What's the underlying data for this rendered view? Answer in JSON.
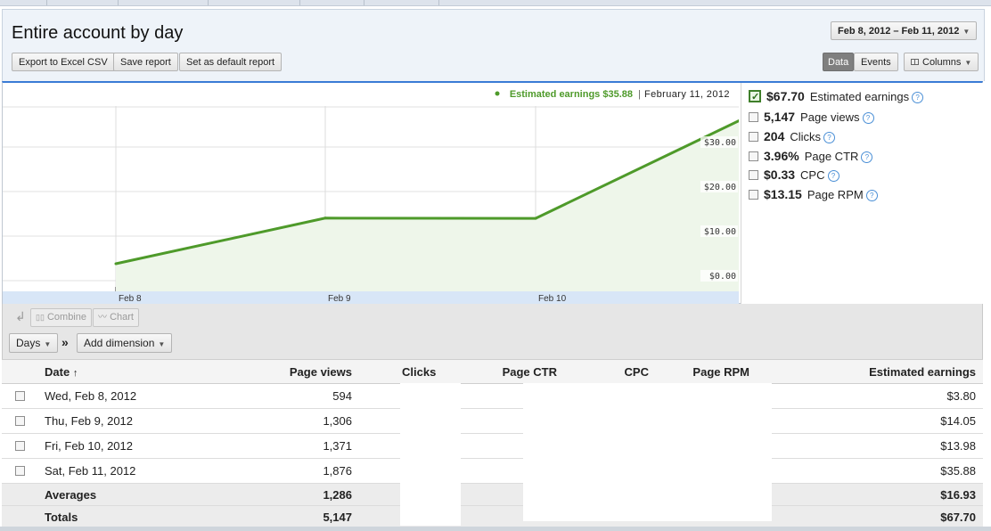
{
  "header": {
    "title": "Entire account by day",
    "date_range": "Feb 8, 2012 – Feb 11, 2012",
    "export_label": "Export to Excel CSV",
    "save_label": "Save report",
    "default_label": "Set as default report",
    "view_data": "Data",
    "view_events": "Events",
    "columns_label": "Columns"
  },
  "chart": {
    "legend_series": "Estimated earnings $35.88",
    "legend_date": "February 11, 2012",
    "line_color": "#4e9a2a",
    "fill_color": "#eef6ea"
  },
  "chart_data": {
    "type": "area",
    "x": [
      "Feb 8",
      "Feb 9",
      "Feb 10",
      "Feb 11"
    ],
    "xticks": [
      "Feb 8",
      "Feb 9",
      "Feb 10"
    ],
    "yticks": [
      "$0.00",
      "$10.00",
      "$20.00",
      "$30.00"
    ],
    "ylim": [
      0,
      35
    ],
    "series": [
      {
        "name": "Estimated earnings",
        "values": [
          3.8,
          14.05,
          13.98,
          35.88
        ]
      }
    ],
    "grid": true
  },
  "metrics": [
    {
      "value": "$67.70",
      "label": "Estimated earnings",
      "checked": true
    },
    {
      "value": "5,147",
      "label": "Page views",
      "checked": false
    },
    {
      "value": "204",
      "label": "Clicks",
      "checked": false
    },
    {
      "value": "3.96%",
      "label": "Page CTR",
      "checked": false
    },
    {
      "value": "$0.33",
      "label": "CPC",
      "checked": false
    },
    {
      "value": "$13.15",
      "label": "Page RPM",
      "checked": false
    }
  ],
  "toolbar": {
    "combine": "Combine",
    "chart": "Chart",
    "days": "Days",
    "add_dimension": "Add dimension",
    "separator": "»"
  },
  "table": {
    "headers": [
      "Date",
      "Page views",
      "Clicks",
      "Page CTR",
      "CPC",
      "Page RPM",
      "Estimated earnings"
    ],
    "rows": [
      {
        "date": "Wed, Feb 8, 2012",
        "pageviews": "594",
        "earnings": "$3.80"
      },
      {
        "date": "Thu, Feb 9, 2012",
        "pageviews": "1,306",
        "earnings": "$14.05"
      },
      {
        "date": "Fri, Feb 10, 2012",
        "pageviews": "1,371",
        "earnings": "$13.98"
      },
      {
        "date": "Sat, Feb 11, 2012",
        "pageviews": "1,876",
        "earnings": "$35.88"
      }
    ],
    "averages": {
      "label": "Averages",
      "pageviews": "1,286",
      "earnings": "$16.93"
    },
    "totals": {
      "label": "Totals",
      "pageviews": "5,147",
      "earnings": "$67.70"
    }
  }
}
